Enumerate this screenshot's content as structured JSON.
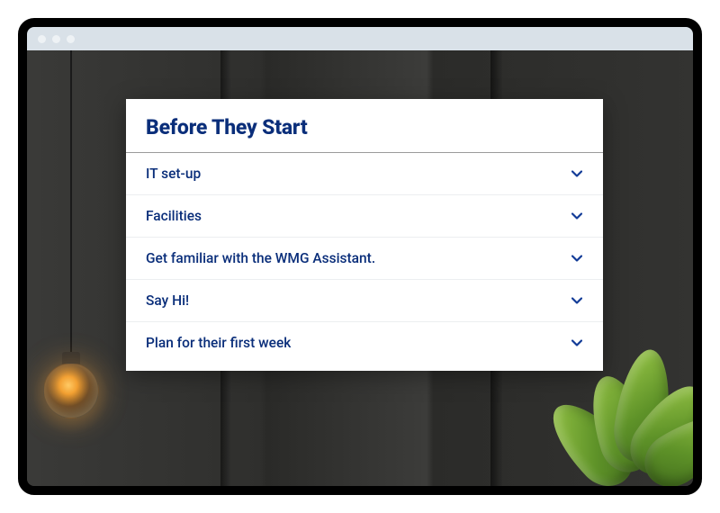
{
  "card": {
    "title": "Before They Start",
    "items": [
      {
        "label": "IT set-up"
      },
      {
        "label": "Facilities"
      },
      {
        "label": "Get familiar with the WMG Assistant."
      },
      {
        "label": "Say Hi!"
      },
      {
        "label": "Plan for their first week"
      }
    ]
  }
}
